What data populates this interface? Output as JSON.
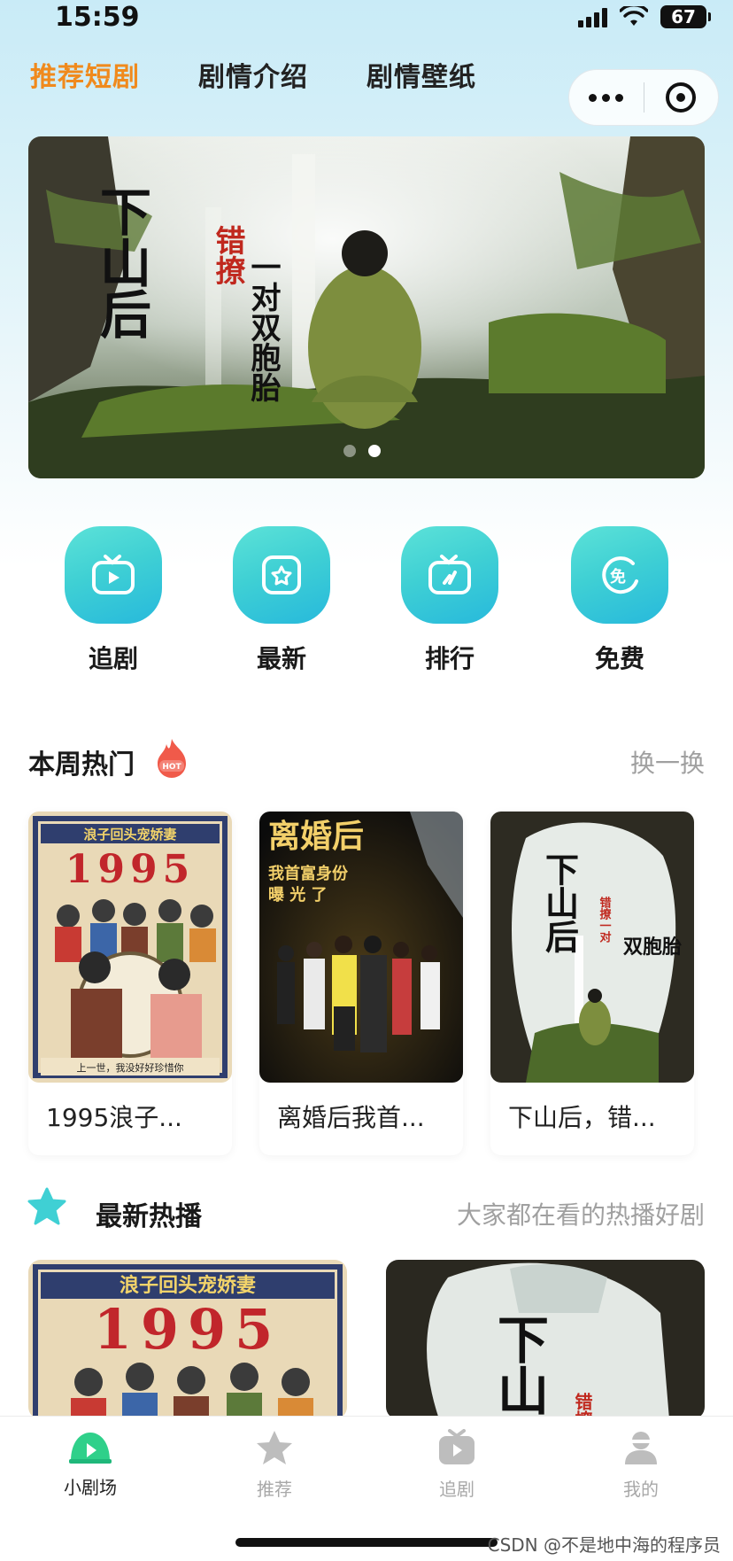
{
  "status": {
    "time": "15:59",
    "battery": "67"
  },
  "header": {
    "tabs": [
      {
        "label": "推荐短剧",
        "active": true
      },
      {
        "label": "剧情介绍",
        "active": false
      },
      {
        "label": "剧情壁纸",
        "active": false
      }
    ]
  },
  "banner": {
    "title": "下山后",
    "subtitle_red": "错撩",
    "subtitle_black": "一对双胞胎",
    "page_count": 2,
    "current_page": 2
  },
  "shortcuts": [
    {
      "label": "追剧",
      "icon": "tv-play-icon"
    },
    {
      "label": "最新",
      "icon": "star-box-icon"
    },
    {
      "label": "排行",
      "icon": "tv-chart-icon"
    },
    {
      "label": "免费",
      "icon": "free-badge-icon"
    }
  ],
  "hot_section": {
    "title": "本周热门",
    "badge": "HOT",
    "action": "换一换",
    "items": [
      {
        "title": "1995浪子...",
        "poster_top": "浪子回头宠娇妻",
        "poster_year": "1995",
        "poster_caption": "上一世，我没好好珍惜你"
      },
      {
        "title": "离婚后我首...",
        "poster_top": "离婚后",
        "poster_line2": "我首富身份",
        "poster_line3": "曝 光 了"
      },
      {
        "title": "下山后，错...",
        "poster_top": "下山后",
        "poster_side": "错撩一对",
        "poster_small": "双胞胎"
      }
    ]
  },
  "new_section": {
    "title": "最新热播",
    "subtitle": "大家都在看的热播好剧",
    "items": [
      {
        "poster_top": "浪子回头宠娇妻",
        "poster_year": "1995"
      },
      {
        "poster_top": "下山后",
        "poster_side": "错撩"
      }
    ]
  },
  "tabbar": [
    {
      "label": "小剧场",
      "icon": "theater-icon",
      "active": true
    },
    {
      "label": "推荐",
      "icon": "star-icon",
      "active": false
    },
    {
      "label": "追剧",
      "icon": "tv-icon",
      "active": false
    },
    {
      "label": "我的",
      "icon": "user-icon",
      "active": false
    }
  ],
  "watermark": "CSDN @不是地中海的程序员",
  "colors": {
    "accent": "#f08a1d",
    "teal": "#3fd0d4",
    "inactive": "#a8a8a8"
  }
}
